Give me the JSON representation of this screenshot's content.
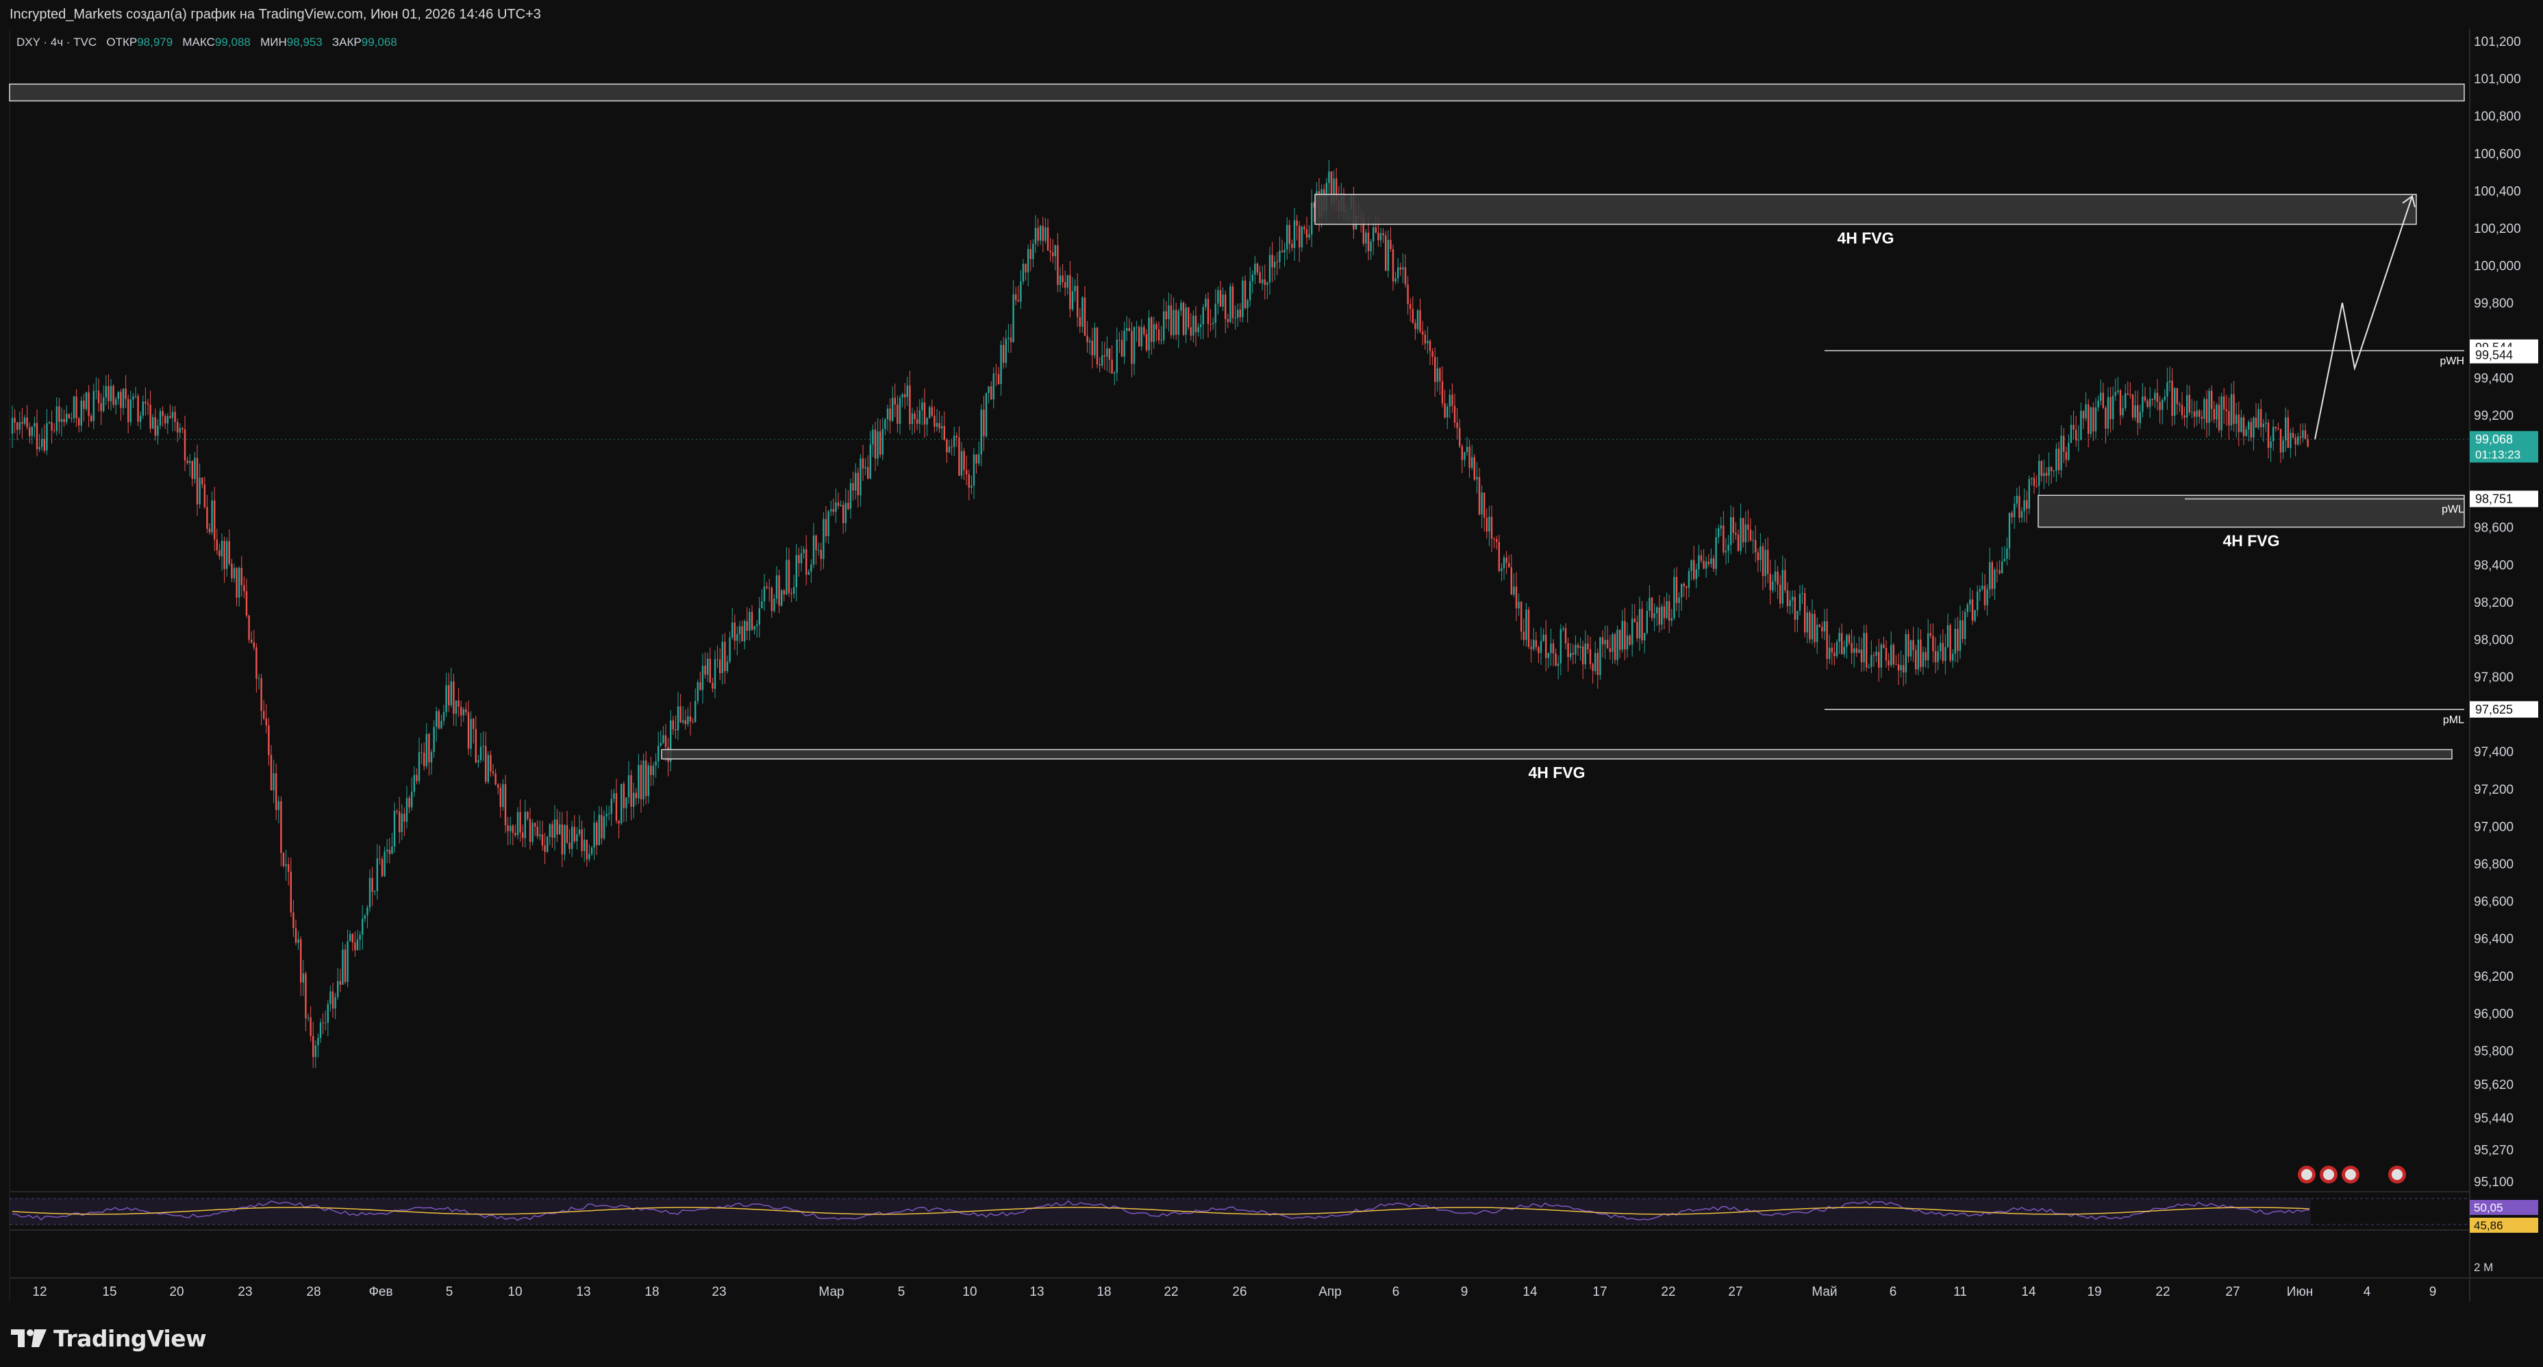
{
  "header": {
    "caption": "Incrypted_Markets создал(а) график на TradingView.com, Июн 01, 2026 14:46 UTC+3"
  },
  "legend": {
    "symbol": "DXY · 4ч · TVC",
    "open_label": "ОТКР",
    "open_value": "98,979",
    "high_label": "МАКС",
    "high_value": "99,088",
    "low_label": "МИН",
    "low_value": "98,953",
    "close_label": "ЗАКР",
    "close_value": "99,068"
  },
  "colors": {
    "background": "#0f0f0f",
    "up_candle": "#26a69a",
    "down_candle": "#ef5350",
    "zone_fill": "#3a3a3a",
    "zone_stroke": "#d9d9d9",
    "rsi_line": "#7e57c2",
    "rsi_ma": "#f0c040",
    "price_badge": "#26a69a"
  },
  "chart_data": {
    "type": "candlestick",
    "symbol": "DXY",
    "timeframe": "4ч",
    "ylim": [
      95.1,
      101.2
    ],
    "y_ticks": [
      "101,200",
      "101,000",
      "100,800",
      "100,600",
      "100,400",
      "100,200",
      "100,000",
      "99,800",
      "99,400",
      "99,200",
      "98,600",
      "98,400",
      "98,200",
      "98,000",
      "97,800",
      "97,400",
      "97,200",
      "97,000",
      "96,800",
      "96,600",
      "96,400",
      "96,200",
      "96,000",
      "95,800",
      "95,620",
      "95,440",
      "95,270",
      "95,100"
    ],
    "x_ticks": [
      "12",
      "15",
      "20",
      "23",
      "28",
      "Фев",
      "5",
      "10",
      "13",
      "18",
      "23",
      "Мар",
      "5",
      "10",
      "13",
      "18",
      "22",
      "26",
      "Апр",
      "6",
      "9",
      "14",
      "17",
      "22",
      "27",
      "Май",
      "6",
      "11",
      "14",
      "19",
      "22",
      "27",
      "Июн",
      "4",
      "9"
    ],
    "price_path": [
      [
        "12",
        99.1
      ],
      [
        "15",
        99.3
      ],
      [
        "20",
        99.1
      ],
      [
        "23",
        98.2
      ],
      [
        "28",
        95.8
      ],
      [
        "Фев",
        96.8
      ],
      [
        "5",
        97.7
      ],
      [
        "10",
        97.0
      ],
      [
        "13",
        96.9
      ],
      [
        "18",
        97.3
      ],
      [
        "23",
        97.9
      ],
      [
        "Мар",
        98.6
      ],
      [
        "5",
        99.3
      ],
      [
        "10",
        98.9
      ],
      [
        "13",
        100.2
      ],
      [
        "18",
        99.5
      ],
      [
        "22",
        99.7
      ],
      [
        "26",
        99.8
      ],
      [
        "Апр",
        100.4
      ],
      [
        "6",
        100.0
      ],
      [
        "9",
        99.0
      ],
      [
        "14",
        98.0
      ],
      [
        "17",
        97.9
      ],
      [
        "22",
        98.2
      ],
      [
        "27",
        98.6
      ],
      [
        "Май",
        98.0
      ],
      [
        "6",
        97.9
      ],
      [
        "11",
        98.0
      ],
      [
        "14",
        98.8
      ],
      [
        "19",
        99.2
      ],
      [
        "22",
        99.3
      ],
      [
        "27",
        99.2
      ],
      [
        "Июн",
        99.07
      ]
    ],
    "fvg_zones": [
      {
        "label": "4H FVG",
        "top": 100.38,
        "bottom": 100.22
      },
      {
        "label": "4H FVG",
        "top": 98.77,
        "bottom": 98.6
      },
      {
        "label": "4H FVG",
        "top": 97.41,
        "bottom": 97.36
      },
      {
        "label": "",
        "top": 100.97,
        "bottom": 100.88
      }
    ],
    "levels": [
      {
        "label": "pWH",
        "value": 99.544
      },
      {
        "label": "pWL",
        "value": 98.751
      },
      {
        "label": "pML",
        "value": 97.625
      }
    ],
    "price_badges": [
      {
        "text": "99,544"
      },
      {
        "text": "99,544"
      },
      {
        "text": "99,068",
        "sub": "01:13:23"
      },
      {
        "text": "98,751"
      },
      {
        "text": "97,625"
      }
    ],
    "projection": [
      99.07,
      99.8,
      99.45,
      100.37
    ],
    "rsi": {
      "value": "50,05",
      "ma": "45,86",
      "volume_label": "2 M"
    }
  },
  "footer": {
    "brand": "TradingView"
  }
}
